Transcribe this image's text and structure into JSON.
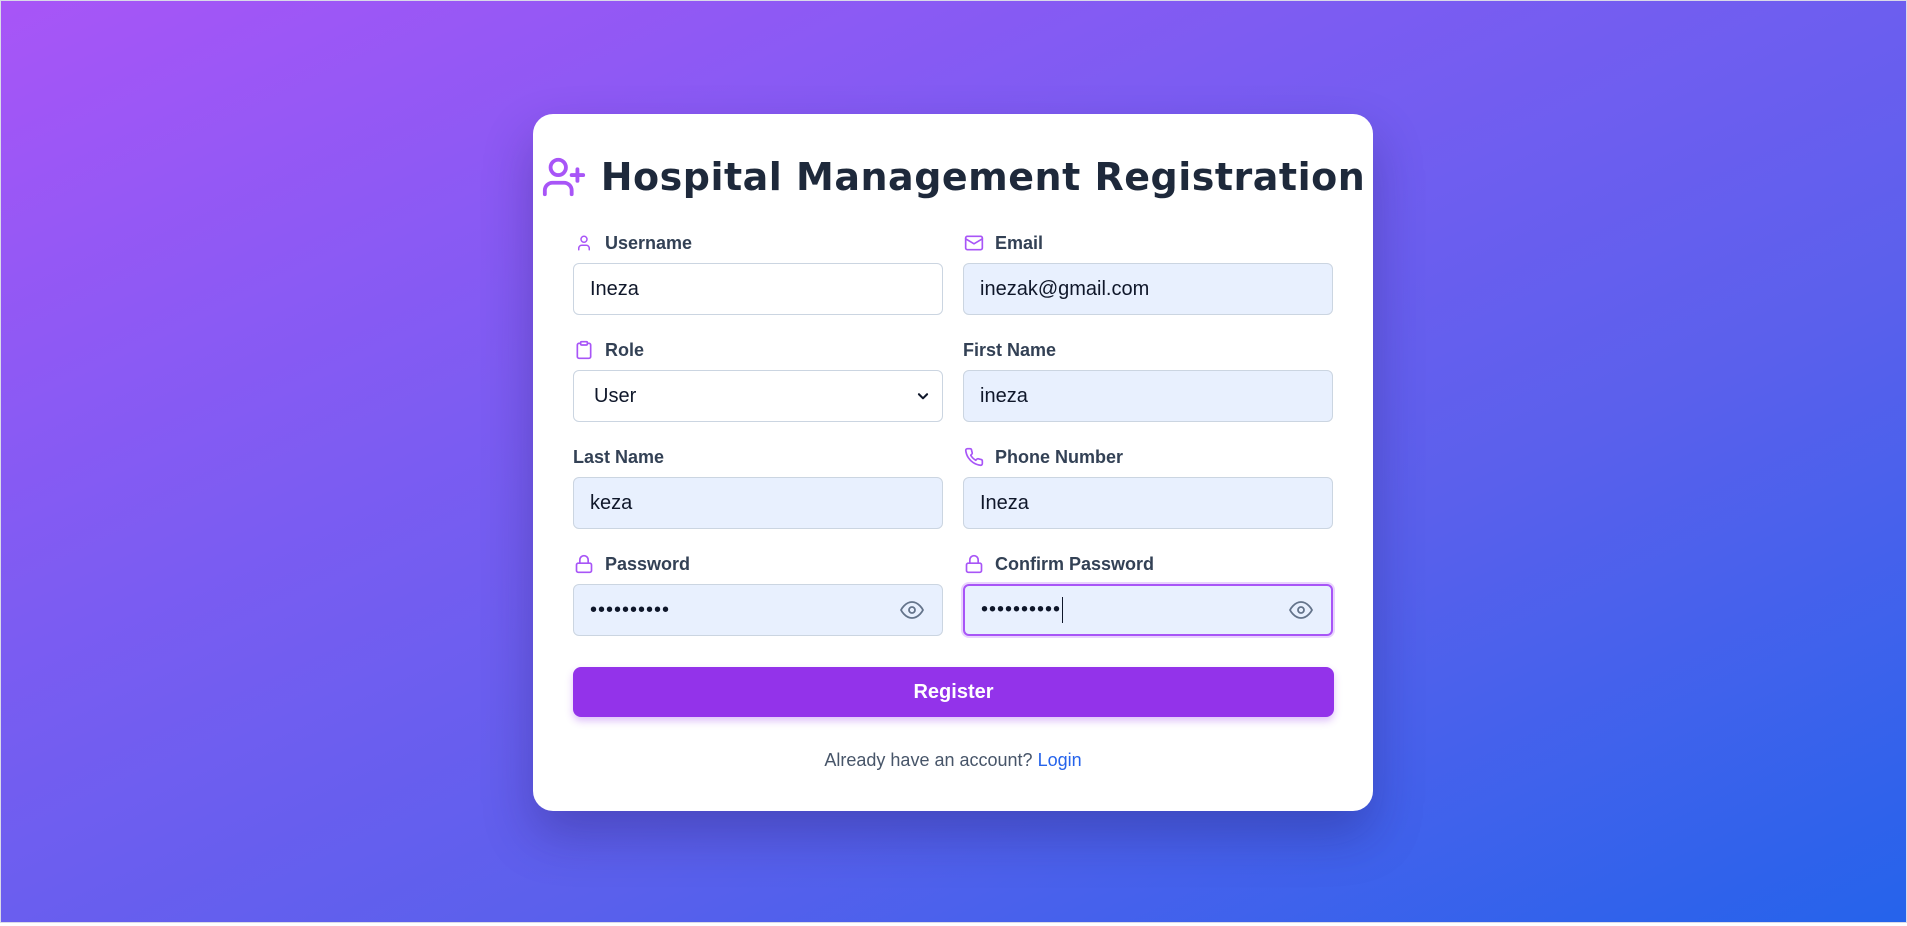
{
  "header": {
    "title": "Hospital Management Registration",
    "icon": "user-plus-icon"
  },
  "form": {
    "username": {
      "label": "Username",
      "value": "Ineza",
      "icon": "user-icon"
    },
    "email": {
      "label": "Email",
      "value": "inezak@gmail.com",
      "icon": "mail-icon"
    },
    "role": {
      "label": "Role",
      "value": "User",
      "icon": "clipboard-icon"
    },
    "first_name": {
      "label": "First Name",
      "value": "ineza"
    },
    "last_name": {
      "label": "Last Name",
      "value": "keza"
    },
    "phone": {
      "label": "Phone Number",
      "value": "Ineza",
      "icon": "phone-icon"
    },
    "password": {
      "label": "Password",
      "value": "••••••••••",
      "icon": "lock-icon"
    },
    "confirm_password": {
      "label": "Confirm Password",
      "value": "••••••••••",
      "icon": "lock-icon"
    }
  },
  "actions": {
    "register_label": "Register"
  },
  "footer": {
    "prompt": "Already have an account?",
    "login_label": "Login"
  },
  "colors": {
    "accent": "#9333ea",
    "icon": "#a855f7",
    "link": "#2563eb",
    "gradient_start": "#a855f7",
    "gradient_end": "#2563eb"
  }
}
